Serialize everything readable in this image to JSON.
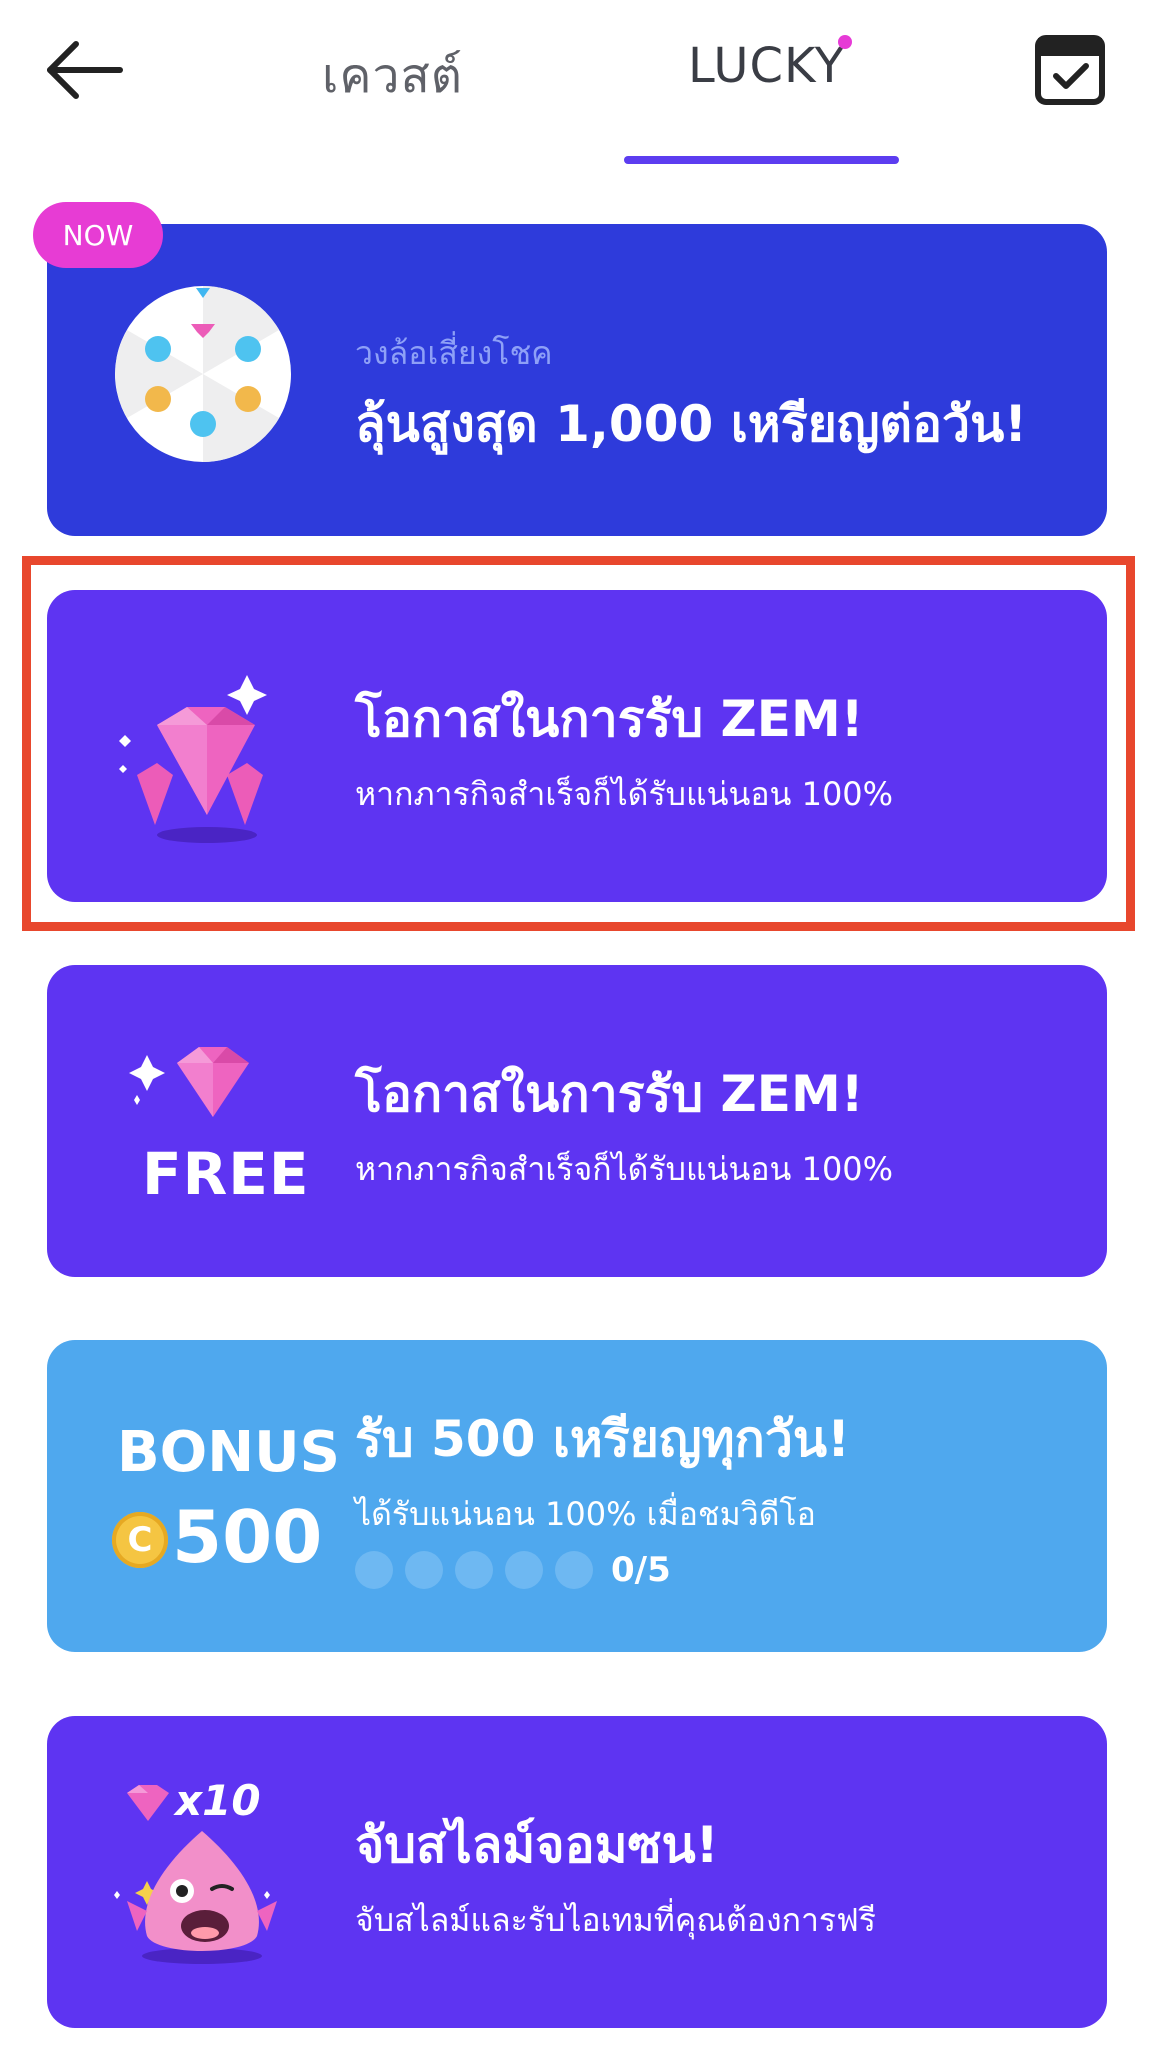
{
  "header": {
    "back_icon": "arrow-left-icon",
    "tabs": [
      {
        "label": "เควสต์",
        "active": false
      },
      {
        "label": "LUCKY",
        "active": true,
        "has_notification_dot": true
      }
    ],
    "checkin_icon": "calendar-check-icon"
  },
  "cards": [
    {
      "badge": "NOW",
      "caption": "วงล้อเสี่ยงโชค",
      "title": "ลุ้นสูงสุด 1,000 เหรียญต่อวัน!",
      "icon": "lucky-wheel-icon",
      "background": "#2e3bdb"
    },
    {
      "title": "โอกาสในการรับ ZEM!",
      "subtitle": "หากภารกิจสำเร็จก็ได้รับแน่นอน 100%",
      "icon": "gems-pile-icon",
      "background": "#5e34f2",
      "highlighted": true
    },
    {
      "title": "โอกาสในการรับ ZEM!",
      "subtitle": "หากภารกิจสำเร็จก็ได้รับแน่นอน 100%",
      "icon": "gem-free-icon",
      "icon_label": "FREE",
      "background": "#5e34f2"
    },
    {
      "title": "รับ 500 เหรียญทุกวัน!",
      "subtitle": "ได้รับแน่นอน 100% เมื่อชมวิดีโอ",
      "icon_label": "BONUS",
      "coin_letter": "C",
      "bonus_value": "500",
      "progress": {
        "current": 0,
        "total": 5,
        "text": "0/5"
      },
      "background": "#4fa8ee"
    },
    {
      "title": "จับสไลม์จอมซน!",
      "subtitle": "จับสไลม์และรับไอเทมที่คุณต้องการฟรี",
      "icon": "slime-gem-x10-icon",
      "icon_label": "x10",
      "background": "#5e34f2"
    }
  ],
  "colors": {
    "accent": "#5c3df0",
    "notification_dot": "#e63ad6",
    "highlight_border": "#e8472d",
    "gem_pink": "#ec5cb8"
  }
}
